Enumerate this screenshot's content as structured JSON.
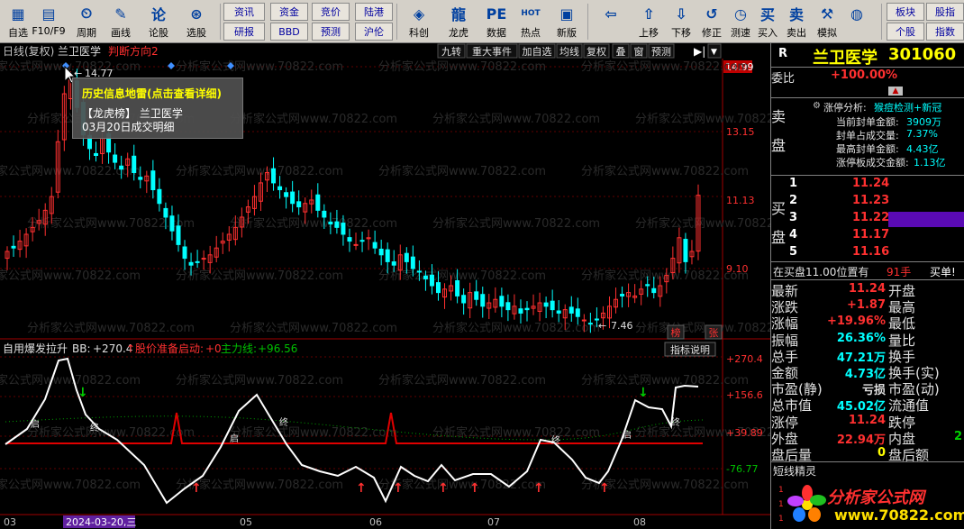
{
  "toolbar": {
    "items": [
      {
        "id": "zixuan",
        "label": "自选",
        "icon": "▦"
      },
      {
        "id": "f10",
        "label": "F10/F9",
        "icon": "▤"
      },
      {
        "id": "zhouqi",
        "label": "周期",
        "icon": "⏲"
      },
      {
        "id": "huaxian",
        "label": "画线",
        "icon": "✎"
      },
      {
        "id": "lunzheng",
        "label": "论股",
        "icon": "论"
      },
      {
        "id": "xuangu",
        "label": "选股",
        "icon": "⊛"
      }
    ],
    "grid_buttons_top": [
      "资讯",
      "资金",
      "竞价",
      "陆港"
    ],
    "grid_buttons_bottom": [
      "研报",
      "BBD",
      "预测",
      "沪伦"
    ],
    "items2": [
      {
        "id": "kechuang",
        "label": "科创",
        "icon": "◈"
      },
      {
        "id": "longhu",
        "label": "龙虎",
        "icon": "龍"
      },
      {
        "id": "shuju",
        "label": "数据",
        "icon": "PE"
      },
      {
        "id": "redian",
        "label": "热点",
        "icon": "HOT"
      },
      {
        "id": "xinban",
        "label": "新版",
        "icon": "▣"
      }
    ],
    "items3": [
      {
        "id": "houtui",
        "label": "",
        "icon": "⇦"
      },
      {
        "id": "shangyi",
        "label": "上移",
        "icon": "⇧"
      },
      {
        "id": "xiayi",
        "label": "下移",
        "icon": "⇩"
      },
      {
        "id": "xiuzheng",
        "label": "修正",
        "icon": "↺"
      },
      {
        "id": "celsu",
        "label": "测速",
        "icon": "◷"
      },
      {
        "id": "mairu",
        "label": "买入",
        "icon": "买"
      },
      {
        "id": "maichu",
        "label": "卖出",
        "icon": "卖"
      },
      {
        "id": "moni",
        "label": "模拟",
        "icon": "⚒"
      },
      {
        "id": "wangluo",
        "label": "",
        "icon": "◍"
      }
    ],
    "right_buttons_top": [
      "板块",
      "股指"
    ],
    "right_buttons_bottom": [
      "个股",
      "指数"
    ]
  },
  "chart": {
    "header": {
      "period": "日线(复权)",
      "stock": "兰卫医学",
      "signal": "判断方向2"
    },
    "header_buttons": [
      "九转",
      "重大事件",
      "加自选",
      "均线",
      "复权",
      "叠",
      "窗",
      "预测"
    ],
    "price_labels": [
      "14.99",
      "13.15",
      "11.13",
      "9.10"
    ],
    "high_label": "14.77",
    "low_label": "7.46",
    "badge_bang": "榜",
    "badge_zhang": "张",
    "watermark": "分析家公式网www.70822.com",
    "indicator": {
      "name": "自用爆发拉升",
      "bb_label": "BB:",
      "bb_value": "+270.4",
      "up_arrow": "↑",
      "p1_label": "股价准备启动:",
      "p1_value": "+0",
      "p2_label": "主力线:",
      "p2_value": "+96.56",
      "button": "指标说明",
      "scale": [
        "+270.4",
        "+156.6",
        "+39.89",
        "-76.77"
      ],
      "marks": [
        "启",
        "终"
      ]
    },
    "x_axis": [
      "03",
      "2024-03-20,三",
      "05",
      "06",
      "07",
      "08"
    ],
    "tooltip": {
      "title": "历史信息地雷(点击查看详细)",
      "line1": "【龙虎榜】 兰卫医学",
      "line2": "03月20日成交明细"
    }
  },
  "quote": {
    "r_label": "R",
    "name": "兰卫医学",
    "code": "301060",
    "weibi_label": "委比",
    "weibi_value": "+100.00%",
    "sell_label_1": "卖",
    "sell_label_2": "盘",
    "buy_label_1": "买",
    "buy_label_2": "盘",
    "zt_analysis_label": "涨停分析:",
    "zt_analysis_value": "猴痘检测+新冠",
    "zt_rows": [
      {
        "label": "当前封单金额:",
        "value": "3909万"
      },
      {
        "label": "封单占成交量:",
        "value": "7.37%"
      },
      {
        "label": "最高封单金额:",
        "value": "4.43亿"
      },
      {
        "label": "涨停板成交金额:",
        "value": "1.13亿"
      }
    ],
    "bids": [
      {
        "n": "1",
        "p": "11.24",
        "v": ""
      },
      {
        "n": "2",
        "p": "11.23",
        "v": ""
      },
      {
        "n": "3",
        "p": "11.22",
        "v": ""
      },
      {
        "n": "4",
        "p": "11.17",
        "v": ""
      },
      {
        "n": "5",
        "p": "11.16",
        "v": ""
      }
    ],
    "queue_label": "在买盘11.00位置有",
    "queue_value": "91手",
    "queue_tail": "买单!",
    "stats": [
      {
        "l1": "最新",
        "v1": "11.24",
        "c1": "r",
        "l2": "开盘",
        "v2": "",
        "c2": "r"
      },
      {
        "l1": "涨跌",
        "v1": "+1.87",
        "c1": "r",
        "l2": "最高",
        "v2": "",
        "c2": "r"
      },
      {
        "l1": "涨幅",
        "v1": "+19.96%",
        "c1": "r",
        "l2": "最低",
        "v2": "",
        "c2": "r"
      },
      {
        "l1": "振幅",
        "v1": "26.36%",
        "c1": "c",
        "l2": "量比",
        "v2": "",
        "c2": "r"
      },
      {
        "l1": "总手",
        "v1": "47.21万",
        "c1": "c",
        "l2": "换手",
        "v2": "",
        "c2": "y"
      },
      {
        "l1": "金额",
        "v1": "4.73亿",
        "c1": "c",
        "l2": "换手(实)",
        "v2": "",
        "c2": "y"
      },
      {
        "l1": "市盈(静)",
        "v1": "亏损",
        "c1": "w",
        "l2": "市盈(动)",
        "v2": "",
        "c2": "w"
      },
      {
        "l1": "总市值",
        "v1": "45.02亿",
        "c1": "c",
        "l2": "流通值",
        "v2": "",
        "c2": "c"
      },
      {
        "l1": "涨停",
        "v1": "11.24",
        "c1": "r",
        "l2": "跌停",
        "v2": "",
        "c2": "g"
      },
      {
        "l1": "外盘",
        "v1": "22.94万",
        "c1": "r",
        "l2": "内盘",
        "v2": "2",
        "c2": "g"
      },
      {
        "l1": "盘后量",
        "v1": "0",
        "c1": "y",
        "l2": "盘后额",
        "v2": "",
        "c2": "y"
      }
    ],
    "short_title": "短线精灵",
    "logo_text": "分析家公式网",
    "logo_url": "www.70822.com"
  }
}
